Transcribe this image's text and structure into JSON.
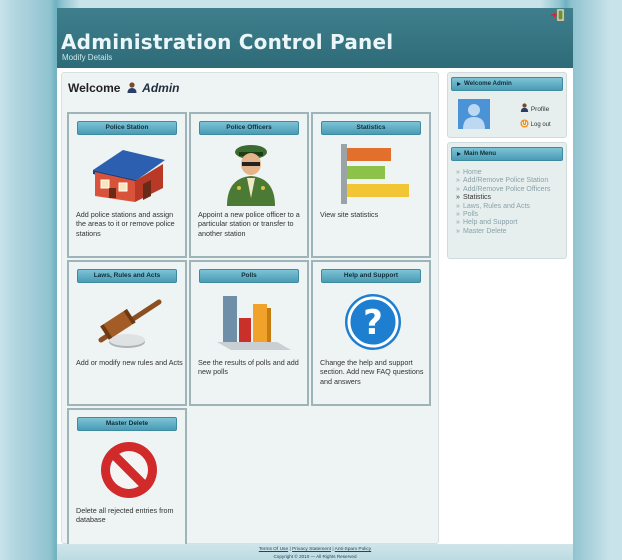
{
  "header": {
    "title": "Administration Control Panel",
    "subtitle": "Modify Details",
    "exit_icon": "exit-door-icon"
  },
  "welcome": {
    "prefix": "Welcome",
    "admin_name": "Admin",
    "icon": "user-icon"
  },
  "tiles": [
    {
      "heading": "Police Station",
      "description": "Add police stations and assign the areas to it or remove police stations",
      "icon": "house-icon"
    },
    {
      "heading": "Police Officers",
      "description": "Appoint a new police officer to a particular station or transfer to another station",
      "icon": "police-officer-icon"
    },
    {
      "heading": "Statistics",
      "description": "View site statistics",
      "icon": "horizontal-bars-icon"
    },
    {
      "heading": "Laws, Rules and Acts",
      "description": "Add or modify new rules and Acts",
      "icon": "gavel-icon"
    },
    {
      "heading": "Polls",
      "description": "See the results of polls and add new polls",
      "icon": "bar-chart-icon"
    },
    {
      "heading": "Help and Support",
      "description": "Change the help and support section. Add new FAQ questions and answers",
      "icon": "question-mark-icon"
    },
    {
      "heading": "Master Delete",
      "description": "Delete all rejected entries from database",
      "icon": "prohibited-icon"
    }
  ],
  "sidebar": {
    "welcome_box": {
      "heading": "Welcome Admin",
      "profile_label": "Profile",
      "logout_label": "Log out",
      "avatar_icon": "avatar-silhouette-icon"
    },
    "main_menu": {
      "heading": "Main Menu",
      "items": [
        {
          "label": "Home",
          "active": false
        },
        {
          "label": "Add/Remove Police Station",
          "active": false
        },
        {
          "label": "Add/Remove Police Officers",
          "active": false
        },
        {
          "label": "Statistics",
          "active": true
        },
        {
          "label": "Laws, Rules and Acts",
          "active": false
        },
        {
          "label": "Polls",
          "active": false
        },
        {
          "label": "Help and Support",
          "active": false
        },
        {
          "label": "Master Delete",
          "active": false
        }
      ]
    }
  },
  "footer": {
    "terms": "Terms Of Use",
    "separator": "|",
    "privacy": "Privacy Statement",
    "antispam": "Anti-Spam Policy",
    "copyright": "Copyright © 2010 — All Rights Reserved"
  },
  "colors": {
    "header_bg": "#2e6b78",
    "tile_heading_bg": "#4a9bb4",
    "panel_bg": "#eef3f3",
    "page_side_bg": "#8fc3cf"
  }
}
